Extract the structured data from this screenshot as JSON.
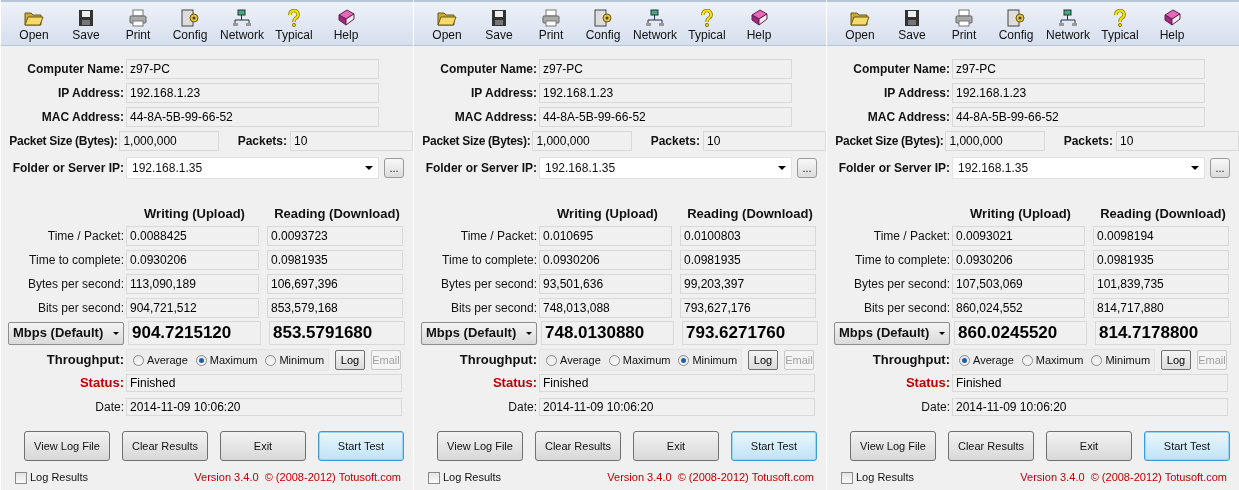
{
  "panels": [
    {
      "toolbar": [
        "Open",
        "Save",
        "Print",
        "Config",
        "Network",
        "Typical",
        "Help"
      ],
      "info": [
        {
          "label": "Computer Name:",
          "value": "z97-PC"
        },
        {
          "label": "IP Address:",
          "value": "192.168.1.23"
        },
        {
          "label": "MAC Address:",
          "value": "44-8A-5B-99-66-52"
        }
      ],
      "packet_size": {
        "label": "Packet Size (Bytes):",
        "value": "1,000,000"
      },
      "packets": {
        "label": "Packets:",
        "value": "10"
      },
      "folder": {
        "label": "Folder or Server IP:",
        "value": "192.168.1.35",
        "browse": "..."
      },
      "columns": [
        "Writing (Upload)",
        "Reading (Download)"
      ],
      "rows": [
        {
          "label": "Time / Packet:",
          "writing": "0.0088425",
          "reading": "0.0093723"
        },
        {
          "label": "Time to complete:",
          "writing": "0.0930206",
          "reading": "0.0981935"
        },
        {
          "label": "Bytes per second:",
          "writing": "113,090,189",
          "reading": "106,697,396"
        },
        {
          "label": "Bits per second:",
          "writing": "904,721,512",
          "reading": "853,579,168"
        }
      ],
      "unit": {
        "label": "Mbps (Default)",
        "writing": "904.7215120",
        "reading": "853.5791680"
      },
      "throughput": {
        "label": "Throughput:",
        "options": [
          {
            "label": "Average",
            "selected": false
          },
          {
            "label": "Maximum",
            "selected": true
          },
          {
            "label": "Minimum",
            "selected": false
          }
        ],
        "log": {
          "label": "Log",
          "disabled": false
        },
        "email": {
          "label": "Email",
          "disabled": true
        }
      },
      "status": {
        "label": "Status:",
        "value": "Finished"
      },
      "date": {
        "label": "Date:",
        "value": "2014-11-09 10:06:20"
      },
      "buttons": [
        {
          "label": "View Log File",
          "default": false
        },
        {
          "label": "Clear Results",
          "default": false
        },
        {
          "label": "Exit",
          "default": false
        },
        {
          "label": "Start Test",
          "default": true
        }
      ],
      "log_results": {
        "label": "Log Results",
        "checked": false
      },
      "version": "Version 3.4.0  © (2008-2012) Totusoft.com"
    },
    {
      "toolbar": [
        "Open",
        "Save",
        "Print",
        "Config",
        "Network",
        "Typical",
        "Help"
      ],
      "info": [
        {
          "label": "Computer Name:",
          "value": "z97-PC"
        },
        {
          "label": "IP Address:",
          "value": "192.168.1.23"
        },
        {
          "label": "MAC Address:",
          "value": "44-8A-5B-99-66-52"
        }
      ],
      "packet_size": {
        "label": "Packet Size (Bytes):",
        "value": "1,000,000"
      },
      "packets": {
        "label": "Packets:",
        "value": "10"
      },
      "folder": {
        "label": "Folder or Server IP:",
        "value": "192.168.1.35",
        "browse": "..."
      },
      "columns": [
        "Writing (Upload)",
        "Reading (Download)"
      ],
      "rows": [
        {
          "label": "Time / Packet:",
          "writing": "0.010695",
          "reading": "0.0100803"
        },
        {
          "label": "Time to complete:",
          "writing": "0.0930206",
          "reading": "0.0981935"
        },
        {
          "label": "Bytes per second:",
          "writing": "93,501,636",
          "reading": "99,203,397"
        },
        {
          "label": "Bits per second:",
          "writing": "748,013,088",
          "reading": "793,627,176"
        }
      ],
      "unit": {
        "label": "Mbps (Default)",
        "writing": "748.0130880",
        "reading": "793.6271760"
      },
      "throughput": {
        "label": "Throughput:",
        "options": [
          {
            "label": "Average",
            "selected": false
          },
          {
            "label": "Maximum",
            "selected": false
          },
          {
            "label": "Minimum",
            "selected": true
          }
        ],
        "log": {
          "label": "Log",
          "disabled": false
        },
        "email": {
          "label": "Email",
          "disabled": true
        }
      },
      "status": {
        "label": "Status:",
        "value": "Finished"
      },
      "date": {
        "label": "Date:",
        "value": "2014-11-09 10:06:20"
      },
      "buttons": [
        {
          "label": "View Log File",
          "default": false
        },
        {
          "label": "Clear Results",
          "default": false
        },
        {
          "label": "Exit",
          "default": false
        },
        {
          "label": "Start Test",
          "default": true
        }
      ],
      "log_results": {
        "label": "Log Results",
        "checked": false
      },
      "version": "Version 3.4.0  © (2008-2012) Totusoft.com"
    },
    {
      "toolbar": [
        "Open",
        "Save",
        "Print",
        "Config",
        "Network",
        "Typical",
        "Help"
      ],
      "info": [
        {
          "label": "Computer Name:",
          "value": "z97-PC"
        },
        {
          "label": "IP Address:",
          "value": "192.168.1.23"
        },
        {
          "label": "MAC Address:",
          "value": "44-8A-5B-99-66-52"
        }
      ],
      "packet_size": {
        "label": "Packet Size (Bytes):",
        "value": "1,000,000"
      },
      "packets": {
        "label": "Packets:",
        "value": "10"
      },
      "folder": {
        "label": "Folder or Server IP:",
        "value": "192.168.1.35",
        "browse": "..."
      },
      "columns": [
        "Writing (Upload)",
        "Reading (Download)"
      ],
      "rows": [
        {
          "label": "Time / Packet:",
          "writing": "0.0093021",
          "reading": "0.0098194"
        },
        {
          "label": "Time to complete:",
          "writing": "0.0930206",
          "reading": "0.0981935"
        },
        {
          "label": "Bytes per second:",
          "writing": "107,503,069",
          "reading": "101,839,735"
        },
        {
          "label": "Bits per second:",
          "writing": "860,024,552",
          "reading": "814,717,880"
        }
      ],
      "unit": {
        "label": "Mbps (Default)",
        "writing": "860.0245520",
        "reading": "814.7178800"
      },
      "throughput": {
        "label": "Throughput:",
        "options": [
          {
            "label": "Average",
            "selected": true
          },
          {
            "label": "Maximum",
            "selected": false
          },
          {
            "label": "Minimum",
            "selected": false
          }
        ],
        "log": {
          "label": "Log",
          "disabled": false
        },
        "email": {
          "label": "Email",
          "disabled": true
        }
      },
      "status": {
        "label": "Status:",
        "value": "Finished"
      },
      "date": {
        "label": "Date:",
        "value": "2014-11-09 10:06:20"
      },
      "buttons": [
        {
          "label": "View Log File",
          "default": false
        },
        {
          "label": "Clear Results",
          "default": false
        },
        {
          "label": "Exit",
          "default": false
        },
        {
          "label": "Start Test",
          "default": true
        }
      ],
      "log_results": {
        "label": "Log Results",
        "checked": false
      },
      "version": "Version 3.4.0  © (2008-2012) Totusoft.com"
    }
  ]
}
